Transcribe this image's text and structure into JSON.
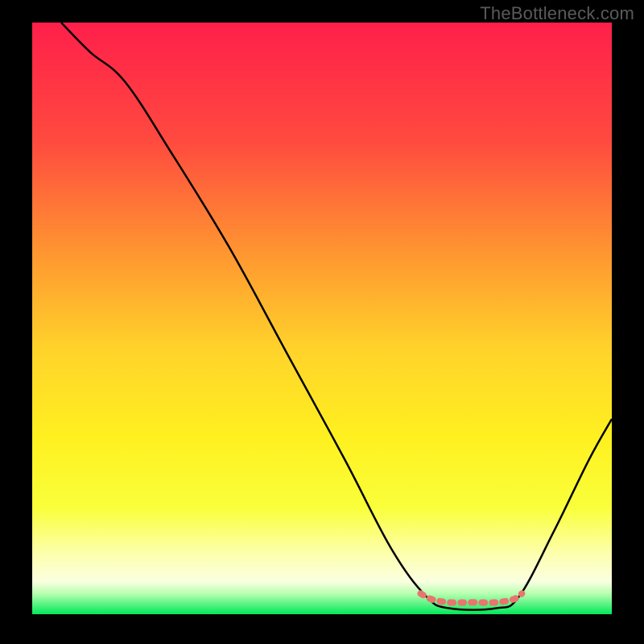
{
  "watermark": "TheBottleneck.com",
  "chart_data": {
    "type": "line",
    "title": "",
    "xlabel": "",
    "ylabel": "",
    "xlim": [
      0,
      100
    ],
    "ylim": [
      0,
      100
    ],
    "gradient_stops": [
      {
        "offset": 0.0,
        "color": "#ff1f4a"
      },
      {
        "offset": 0.2,
        "color": "#ff4a3f"
      },
      {
        "offset": 0.4,
        "color": "#ff9a30"
      },
      {
        "offset": 0.55,
        "color": "#ffd22a"
      },
      {
        "offset": 0.7,
        "color": "#fff020"
      },
      {
        "offset": 0.82,
        "color": "#f9ff3a"
      },
      {
        "offset": 0.9,
        "color": "#fdffb0"
      },
      {
        "offset": 0.945,
        "color": "#faffe0"
      },
      {
        "offset": 0.965,
        "color": "#b8ffb0"
      },
      {
        "offset": 1.0,
        "color": "#00e85a"
      }
    ],
    "series": [
      {
        "name": "bottleneck-curve",
        "color": "#000000",
        "points": [
          {
            "x": 5,
            "y": 100
          },
          {
            "x": 10,
            "y": 95
          },
          {
            "x": 16,
            "y": 90
          },
          {
            "x": 24,
            "y": 78
          },
          {
            "x": 34,
            "y": 62
          },
          {
            "x": 44,
            "y": 44
          },
          {
            "x": 54,
            "y": 26
          },
          {
            "x": 62,
            "y": 11
          },
          {
            "x": 68,
            "y": 3
          },
          {
            "x": 72,
            "y": 1
          },
          {
            "x": 80,
            "y": 1
          },
          {
            "x": 84,
            "y": 3
          },
          {
            "x": 90,
            "y": 14
          },
          {
            "x": 96,
            "y": 26
          },
          {
            "x": 100,
            "y": 33
          }
        ]
      },
      {
        "name": "pink-flat-segment",
        "color": "#e8766f",
        "points": [
          {
            "x": 67,
            "y": 3.5
          },
          {
            "x": 69,
            "y": 2.5
          },
          {
            "x": 72,
            "y": 2.0
          },
          {
            "x": 76,
            "y": 2.0
          },
          {
            "x": 80,
            "y": 2.0
          },
          {
            "x": 83,
            "y": 2.5
          },
          {
            "x": 84.5,
            "y": 3.5
          }
        ]
      }
    ]
  }
}
